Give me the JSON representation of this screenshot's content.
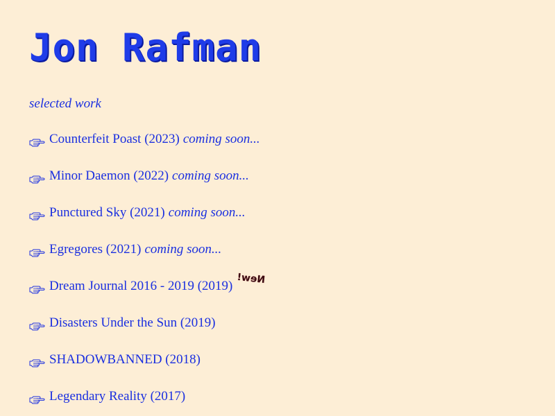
{
  "header": {
    "title": "Jon Rafman",
    "subtitle": "selected work"
  },
  "works": [
    {
      "icon": "pointing-hand-icon",
      "title": "Counterfeit Poast (2023)",
      "status": "coming soon...",
      "badge": ""
    },
    {
      "icon": "pointing-hand-icon",
      "title": "Minor Daemon (2022)",
      "status": "coming soon...",
      "badge": ""
    },
    {
      "icon": "pointing-hand-icon",
      "title": "Punctured Sky (2021)",
      "status": "coming soon...",
      "badge": ""
    },
    {
      "icon": "pointing-hand-icon",
      "title": "Egregores (2021)",
      "status": "coming soon...",
      "badge": ""
    },
    {
      "icon": "pointing-hand-icon",
      "title": "Dream Journal 2016 - 2019 (2019)",
      "status": "",
      "badge": "New!"
    },
    {
      "icon": "pointing-hand-icon",
      "title": "Disasters Under the Sun (2019)",
      "status": "",
      "badge": ""
    },
    {
      "icon": "pointing-hand-icon",
      "title": "SHADOWBANNED (2018)",
      "status": "",
      "badge": ""
    },
    {
      "icon": "pointing-hand-icon",
      "title": "Legendary Reality (2017)",
      "status": "",
      "badge": ""
    }
  ],
  "colors": {
    "background": "#fdeed6",
    "link": "#1a2fe0",
    "badge": "#3a0d12"
  }
}
